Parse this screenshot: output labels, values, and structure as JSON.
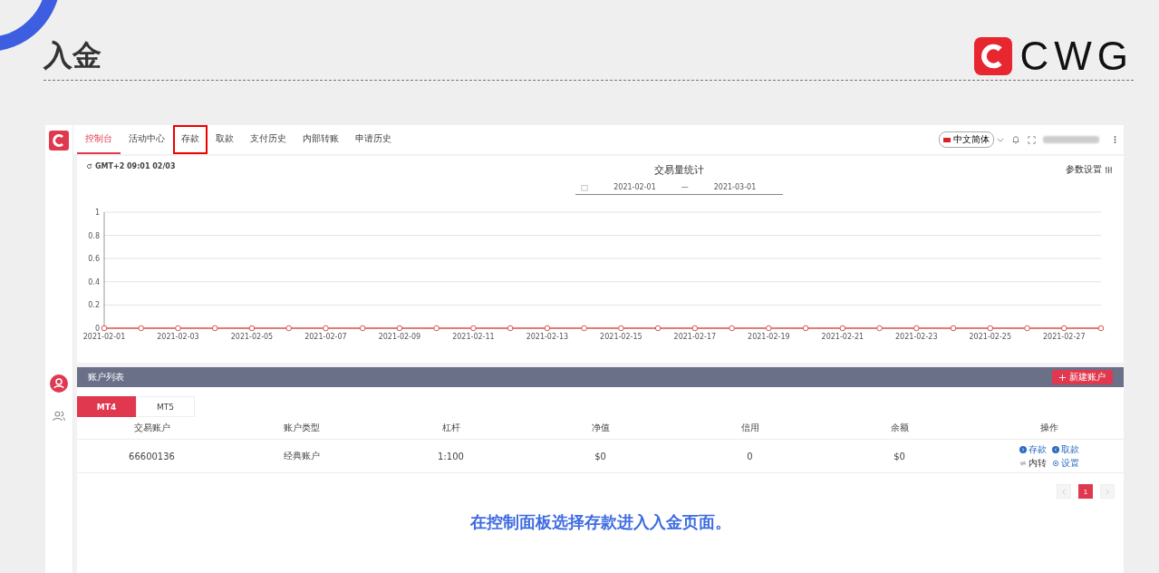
{
  "slide": {
    "title": "入金",
    "brand": "CWG",
    "caption": "在控制面板选择存款进入入金页面。"
  },
  "nav": {
    "tabs": [
      {
        "label": "控制台",
        "selected": true,
        "highlighted": false
      },
      {
        "label": "活动中心",
        "selected": false,
        "highlighted": false
      },
      {
        "label": "存款",
        "selected": false,
        "highlighted": true
      },
      {
        "label": "取款",
        "selected": false,
        "highlighted": false
      },
      {
        "label": "支付历史",
        "selected": false,
        "highlighted": false
      },
      {
        "label": "内部转账",
        "selected": false,
        "highlighted": false
      },
      {
        "label": "申请历史",
        "selected": false,
        "highlighted": false
      }
    ],
    "language": "中文简体"
  },
  "stats": {
    "time": "GMT+2 09:01 02/03",
    "title": "交易量统计",
    "date_from": "2021-02-01",
    "date_sep": "—",
    "date_to": "2021-03-01",
    "settings": "参数设置",
    "chart_data": {
      "type": "line",
      "categories": [
        "2021-02-01",
        null,
        "2021-02-03",
        null,
        "2021-02-05",
        null,
        "2021-02-07",
        null,
        "2021-02-09",
        null,
        "2021-02-11",
        null,
        "2021-02-13",
        null,
        "2021-02-15",
        null,
        "2021-02-17",
        null,
        "2021-02-19",
        null,
        "2021-02-21",
        null,
        "2021-02-23",
        null,
        "2021-02-25",
        null,
        "2021-02-27",
        null
      ],
      "series": [
        {
          "color": "#d9534f",
          "marker": true,
          "values": [
            0,
            0,
            0,
            0,
            0,
            0,
            0,
            0,
            0,
            0,
            0,
            0,
            0,
            0,
            0,
            0,
            0,
            0,
            0,
            0,
            0,
            0,
            0,
            0,
            0,
            0,
            0,
            0
          ]
        }
      ],
      "grid": true,
      "ylim": [
        0,
        1
      ],
      "yticks": [
        0,
        0.2,
        0.4,
        0.6,
        0.8,
        {
          "value": 1,
          "label": "1"
        }
      ]
    }
  },
  "accounts": {
    "title": "账户列表",
    "new_button": "新建账户",
    "tabs": [
      {
        "label": "MT4",
        "selected": true
      },
      {
        "label": "MT5",
        "selected": false
      }
    ],
    "columns": [
      "交易账户",
      "账户类型",
      "杠杆",
      "净值",
      "信用",
      "余额",
      "操作"
    ],
    "rows": [
      {
        "cells": [
          "66600136",
          "经典账户",
          "1:100",
          "$0",
          "0",
          "$0"
        ],
        "actions": [
          {
            "kind": "deposit",
            "label": "存款"
          },
          {
            "kind": "withdraw",
            "label": "取款"
          },
          {
            "kind": "transfer",
            "label": "内转"
          },
          {
            "kind": "settings",
            "label": "设置"
          }
        ]
      }
    ],
    "pages": [
      {
        "label": "1",
        "selected": true
      }
    ]
  }
}
